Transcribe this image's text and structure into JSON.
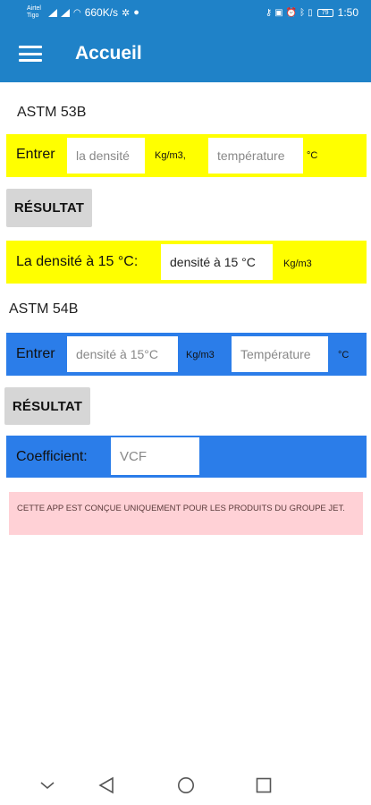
{
  "status_bar": {
    "carrier_line1": "Airtel",
    "carrier_line2": "Tigo",
    "network_speed": "660K/s",
    "battery": "79",
    "time": "1:50"
  },
  "app_bar": {
    "title": "Accueil",
    "menu_icon": "hamburger-menu-icon",
    "color": "#1f82c8"
  },
  "astm_53b": {
    "title": "ASTM 53B",
    "enter_label": "Entrer",
    "density_placeholder": "la densité",
    "density_unit": "Kg/m3,",
    "temperature_placeholder": "température",
    "temperature_unit": "°C",
    "result_button": "RÉSULTAT",
    "result_label": "La densité à 15 °C:",
    "result_placeholder": "densité à 15 °C",
    "result_unit": "Kg/m3",
    "color": "#ffff00"
  },
  "astm_54b": {
    "title": "ASTM 54B",
    "enter_label": "Entrer",
    "density_placeholder": "densité à 15°C",
    "density_unit": "Kg/m3",
    "temperature_placeholder": "Température",
    "temperature_unit": "°C",
    "result_button": "RÉSULTAT",
    "coefficient_label": "Coefficient:",
    "coefficient_placeholder": "VCF",
    "color": "#2b7de9"
  },
  "notice": {
    "text": "CETTE APP EST CONÇUE UNIQUEMENT POUR LES PRODUITS DU GROUPE JET."
  },
  "nav_bar": {
    "icons": [
      "chevron-down-icon",
      "back-triangle-icon",
      "home-circle-icon",
      "recents-square-icon"
    ]
  }
}
